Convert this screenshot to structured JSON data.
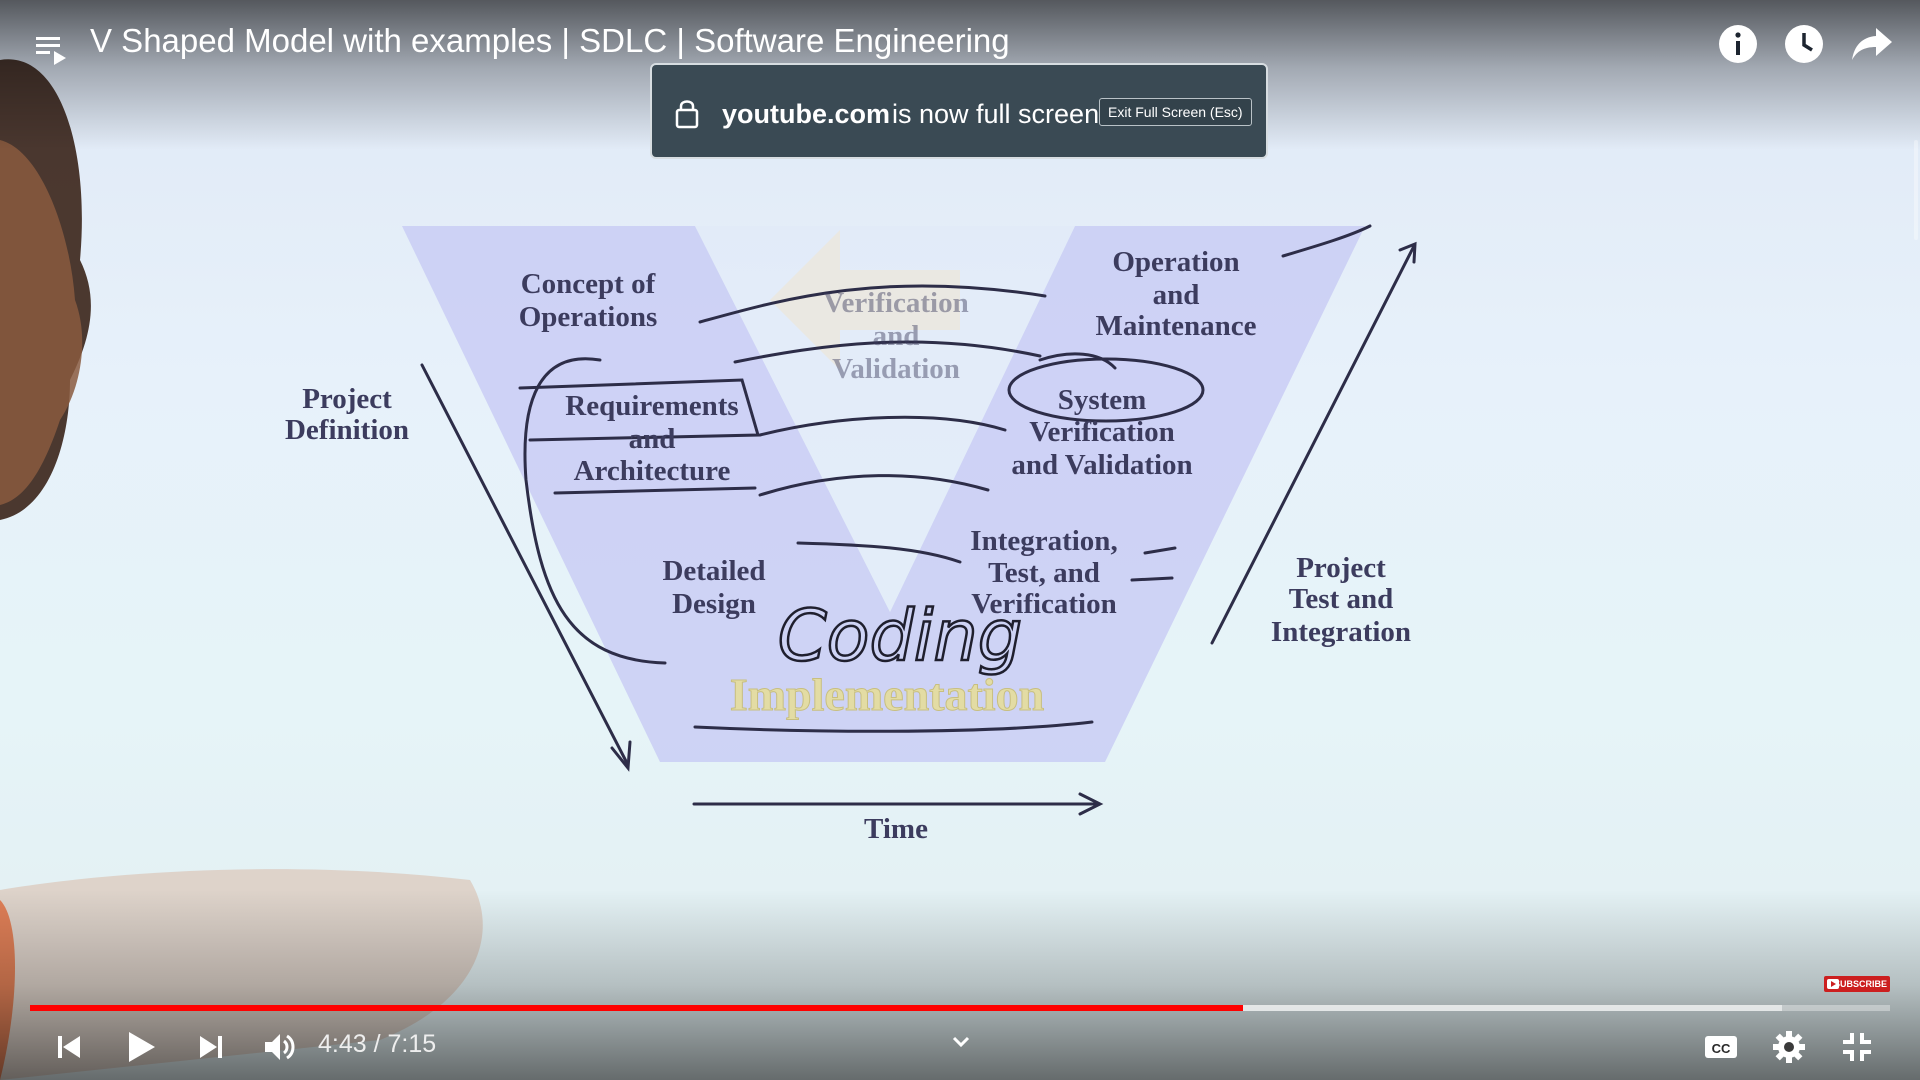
{
  "video": {
    "title": "V Shaped Model with examples | SDLC | Software Engineering",
    "time_display": "4:43 / 7:15",
    "progress_played": 0.652,
    "progress_buffered": 0.942
  },
  "fullscreen_notice": {
    "domain": "youtube.com",
    "message": "is now full screen",
    "exit_button": "Exit Full Screen (Esc)"
  },
  "subscribe_badge": "SUBSCRIBE",
  "diagram": {
    "concept_line1": "Concept of",
    "concept_line2": "Operations",
    "verif_line1": "Verification",
    "verif_line2": "and",
    "verif_line3": "Validation",
    "opmaint_line1": "Operation",
    "opmaint_line2": "and",
    "opmaint_line3": "Maintenance",
    "projdef_line1": "Project",
    "projdef_line2": "Definition",
    "req_line1": "Requirements",
    "req_line2": "and",
    "req_line3": "Architecture",
    "sys_line1": "System",
    "sys_line2": "Verification",
    "sys_line3": "and Validation",
    "integ_line1": "Integration,",
    "integ_line2": "Test, and",
    "integ_line3": "Verification",
    "detailed_line1": "Detailed",
    "detailed_line2": "Design",
    "projtest_line1": "Project",
    "projtest_line2": "Test and",
    "projtest_line3": "Integration",
    "coding": "Coding",
    "implementation": "Implementation",
    "time": "Time"
  },
  "icons": {
    "playlist": "playlist-icon",
    "info": "info-icon",
    "watch_later": "clock-icon",
    "share": "share-icon",
    "prev": "skip-previous-icon",
    "play": "play-icon",
    "next": "skip-next-icon",
    "volume": "volume-icon",
    "chevron": "chevron-down-icon",
    "cc": "captions-icon",
    "settings": "gear-icon",
    "exit_fullscreen": "exit-fullscreen-icon"
  }
}
